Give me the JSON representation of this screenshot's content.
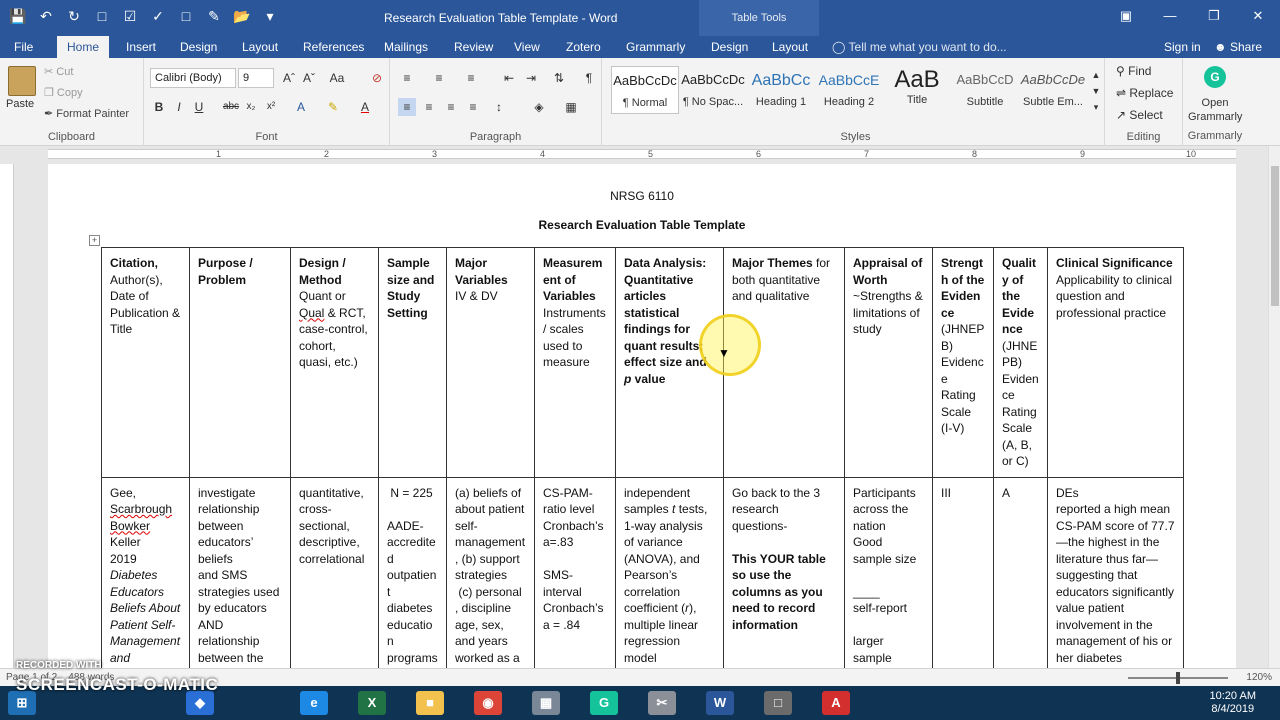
{
  "window": {
    "title": "Research Evaluation Table Template - Word",
    "contextual_tab": "Table Tools",
    "qat_icons": [
      "save-icon",
      "undo-icon",
      "redo-icon",
      "new-doc-icon",
      "checkmark-icon",
      "spelling-icon",
      "comment-icon",
      "tracking-icon",
      "folder-icon"
    ]
  },
  "tabs": [
    "File",
    "Home",
    "Insert",
    "Design",
    "Layout",
    "References",
    "Mailings",
    "Review",
    "View",
    "Zotero",
    "Grammarly",
    "Design",
    "Layout"
  ],
  "active_tab": "Home",
  "tell_me": "Tell me what you want to do...",
  "sign_in": "Sign in",
  "share": "Share",
  "ribbon": {
    "clipboard": {
      "label": "Clipboard",
      "paste": "Paste",
      "cut": "Cut",
      "copy": "Copy",
      "format_painter": "Format Painter"
    },
    "font": {
      "label": "Font",
      "name": "Calibri (Body)",
      "size": "9"
    },
    "paragraph": {
      "label": "Paragraph"
    },
    "styles": {
      "label": "Styles",
      "items": [
        {
          "sample": "AaBbCcDc",
          "name": "¶ Normal"
        },
        {
          "sample": "AaBbCcDc",
          "name": "¶ No Spac..."
        },
        {
          "sample": "AaBbCc",
          "name": "Heading 1"
        },
        {
          "sample": "AaBbCcE",
          "name": "Heading 2"
        },
        {
          "sample": "AaB",
          "name": "Title"
        },
        {
          "sample": "AaBbCcD",
          "name": "Subtitle"
        },
        {
          "sample": "AaBbCcDe",
          "name": "Subtle Em..."
        }
      ]
    },
    "editing": {
      "label": "Editing",
      "find": "Find",
      "replace": "Replace",
      "select": "Select"
    },
    "grammarly": {
      "label": "Grammarly",
      "open": "Open Grammarly"
    }
  },
  "document": {
    "course": "NRSG 6110",
    "heading": "Research Evaluation Table Template"
  },
  "status": {
    "page": "Page 1 of 2",
    "words": "488 words",
    "zoom": "120%"
  },
  "taskbar": {
    "time": "10:20 AM",
    "date": "8/4/2019"
  },
  "watermark": {
    "line1": "RECORDED WITH",
    "line2": "SCREENCAST-O-MATIC"
  },
  "colors": {
    "word_blue": "#2b579a",
    "ribbon_bg": "#f3f3f3",
    "taskbar": "#0f3352",
    "highlight_ring": "#f0cd14"
  }
}
